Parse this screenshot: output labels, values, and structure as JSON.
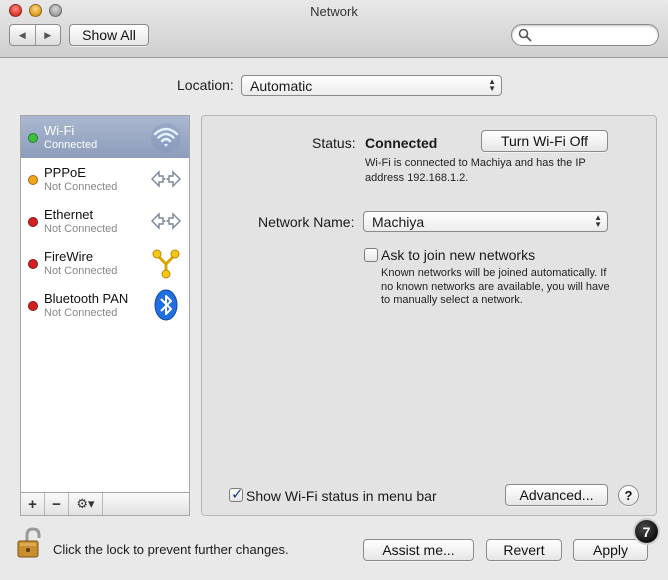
{
  "window": {
    "title": "Network"
  },
  "toolbar": {
    "back_glyph": "◀",
    "forward_glyph": "▶",
    "show_all": "Show All",
    "search_placeholder": ""
  },
  "location": {
    "label": "Location:",
    "value": "Automatic"
  },
  "services": [
    {
      "name": "Wi-Fi",
      "status": "Connected",
      "color": "#3cbf3c",
      "icon": "wifi-icon"
    },
    {
      "name": "PPPoE",
      "status": "Not Connected",
      "color": "#f1a51e",
      "icon": "ethernet-arrows-icon"
    },
    {
      "name": "Ethernet",
      "status": "Not Connected",
      "color": "#d21f1f",
      "icon": "ethernet-arrows-icon"
    },
    {
      "name": "FireWire",
      "status": "Not Connected",
      "color": "#d21f1f",
      "icon": "firewire-icon"
    },
    {
      "name": "Bluetooth PAN",
      "status": "Not Connected",
      "color": "#d21f1f",
      "icon": "bluetooth-icon"
    }
  ],
  "sidebar_tools": {
    "add": "+",
    "remove": "−",
    "gear": "⚙▾"
  },
  "panel": {
    "status_label": "Status:",
    "status_value": "Connected",
    "turn_off_button": "Turn Wi-Fi Off",
    "status_description": "Wi-Fi is connected to Machiya and has the IP address 192.168.1.2.",
    "network_name_label": "Network Name:",
    "network_name_value": "Machiya",
    "ask_join_label": "Ask to join new networks",
    "ask_join_checked": false,
    "ask_join_description": "Known networks will be joined automatically. If no known networks are available, you will have to manually select a network.",
    "show_menubar_label": "Show Wi-Fi status in menu bar",
    "show_menubar_checked": true,
    "advanced_button": "Advanced...",
    "help_button": "?"
  },
  "footer": {
    "lock_text": "Click the lock to prevent further changes.",
    "assist_button": "Assist me...",
    "revert_button": "Revert",
    "apply_button": "Apply",
    "badge_count": "7"
  },
  "colors": {
    "selected_row": "#9aa9c6",
    "accent": "#1b3a8a"
  }
}
